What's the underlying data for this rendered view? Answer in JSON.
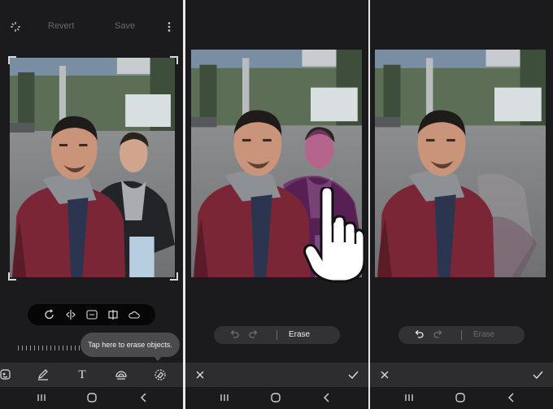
{
  "panel1": {
    "top_bar": {
      "revert_label": "Revert",
      "save_label": "Save"
    },
    "tooltip": "Tap here to erase objects.",
    "tools": [
      "rotate-icon",
      "flip-icon",
      "erase-icon",
      "crop-icon",
      "cloud-icon"
    ],
    "bottom_tools": [
      "sticker-icon",
      "draw-icon",
      "text-icon",
      "style-icon",
      "eraser-icon"
    ]
  },
  "panel2": {
    "erase_bar": {
      "label": "Erase",
      "undo_enabled": false,
      "redo_enabled": false
    }
  },
  "panel3": {
    "erase_bar": {
      "label": "Erase",
      "undo_enabled": true,
      "redo_enabled": false
    }
  },
  "colors": {
    "background": "#1b1b1d",
    "bar": "#2d2d30",
    "tooltip": "#4b4b4e"
  }
}
